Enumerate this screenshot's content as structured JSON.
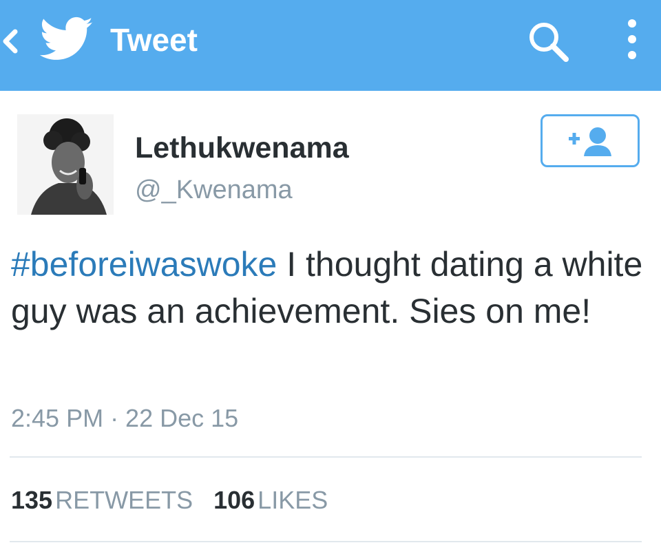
{
  "header": {
    "title": "Tweet",
    "back_icon": "chevron-left-icon",
    "logo_icon": "twitter-bird-icon",
    "search_icon": "search-icon",
    "menu_icon": "more-vertical-icon",
    "color": "#55acee"
  },
  "author": {
    "display_name": "Lethukwenama",
    "handle": "@_Kwenama",
    "follow_icon": "follow-user-icon"
  },
  "tweet": {
    "hashtag": "#beforeiwaswoke",
    "text": " I thought dating a white guy was an achievement. Sies on me!",
    "timestamp": "2:45 PM · 22 Dec 15"
  },
  "stats": {
    "retweets_count": "135",
    "retweets_label": "RETWEETS",
    "likes_count": "106",
    "likes_label": "LIKES"
  },
  "colors": {
    "accent": "#55acee",
    "link": "#2b7bb9",
    "text": "#292f33",
    "muted": "#8899a6"
  }
}
